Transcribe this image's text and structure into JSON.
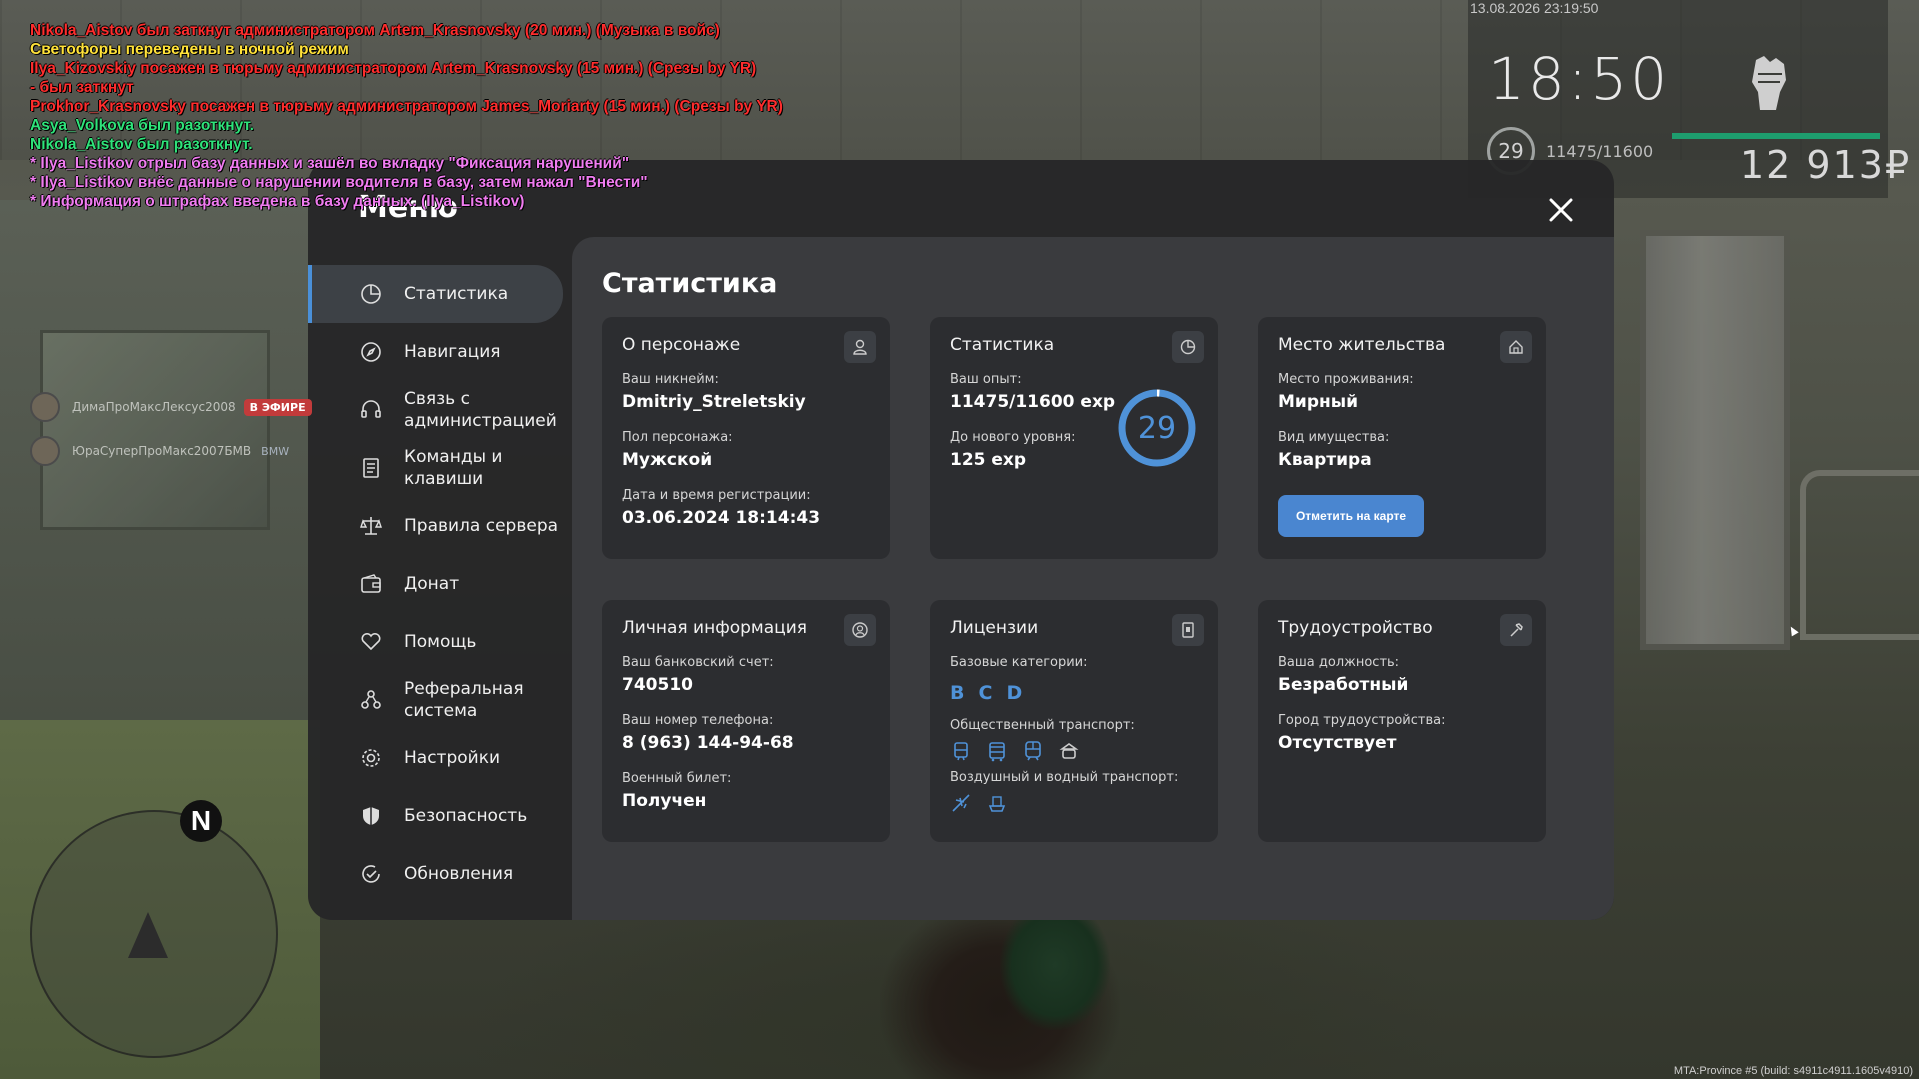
{
  "hud": {
    "datetime": "13.08.2026 23:19:50",
    "time": "18:50",
    "level": "29",
    "exp": "11475/11600",
    "money": "12 913₽",
    "icon": "fist-icon",
    "health_color": "#1e9d6e"
  },
  "chat": [
    {
      "text": "Nikola_Aistov был заткнут администратором Artem_Krasnovsky (20 мин.) (Музыка в войс)",
      "color": "#ff2d2d"
    },
    {
      "text": "Светофоры переведены в ночной режим",
      "color": "#ffe23a"
    },
    {
      "text": "Ilya_Kizovskiy посажен в тюрьму администратором Artem_Krasnovsky (15 мин.) (Срезы by YR)",
      "color": "#ff2d2d"
    },
    {
      "text": "- был заткнут",
      "color": "#ff2d2d"
    },
    {
      "text": "Prokhor_Krasnovsky посажен в тюрьму администратором James_Moriarty (15 мин.) (Срезы by YR)",
      "color": "#ff2d2d"
    },
    {
      "text": "Asya_Volkova был разоткнут.",
      "color": "#2fe37a"
    },
    {
      "text": "Nikola_Aistov был разоткнут.",
      "color": "#2fe37a"
    },
    {
      "text": "* Ilya_Listikov отрыл базу данных и зашёл во вкладку \"Фиксация нарушений\"",
      "color": "#f07cf0"
    },
    {
      "text": "* Ilya_Listikov внёс данные о нарушении водителя в базу, затем нажал \"Внести\"",
      "color": "#f07cf0"
    },
    {
      "text": "* Информация о штрафах введена в базу данных. (Ilya_Listikov)",
      "color": "#f07cf0"
    }
  ],
  "voice": [
    {
      "name": "ДимаПроМаксЛексус2008",
      "badge": "В ЭФИРЕ",
      "car": ""
    },
    {
      "name": "ЮраСуперПроМакс2007БМВ",
      "badge": "",
      "car": "BMW"
    }
  ],
  "radar": {
    "north": "N"
  },
  "build": "MTA:Province #5 (build: s4911c4911.1605v4910)",
  "menu": {
    "title": "Меню",
    "sidebar": [
      {
        "label": "Статистика",
        "icon": "chart-pie-icon"
      },
      {
        "label": "Навигация",
        "icon": "compass-icon"
      },
      {
        "label": "Связь с администрацией",
        "icon": "headset-icon"
      },
      {
        "label": "Команды и клавиши",
        "icon": "document-icon"
      },
      {
        "label": "Правила сервера",
        "icon": "scales-icon"
      },
      {
        "label": "Донат",
        "icon": "wallet-icon"
      },
      {
        "label": "Помощь",
        "icon": "heart-hand-icon"
      },
      {
        "label": "Реферальная система",
        "icon": "referral-icon"
      },
      {
        "label": "Настройки",
        "icon": "gear-icon"
      },
      {
        "label": "Безопасность",
        "icon": "shield-icon"
      },
      {
        "label": "Обновления",
        "icon": "update-icon"
      }
    ],
    "content_title": "Статистика",
    "cards": {
      "character": {
        "title": "О персонаже",
        "nickname_label": "Ваш никнейм:",
        "nickname": "Dmitriy_Streletskiy",
        "gender_label": "Пол персонажа:",
        "gender": "Мужской",
        "reg_label": "Дата и время регистрации:",
        "reg": "03.06.2024 18:14:43"
      },
      "stats": {
        "title": "Статистика",
        "exp_label": "Ваш опыт:",
        "exp": "11475/11600 exp",
        "next_label": "До нового уровня:",
        "next": "125 exp",
        "level": "29",
        "level_progress": 0.989
      },
      "residence": {
        "title": "Место жительства",
        "place_label": "Место проживания:",
        "place": "Мирный",
        "type_label": "Вид имущества:",
        "type": "Квартира",
        "button": "Отметить на карте"
      },
      "personal": {
        "title": "Личная информация",
        "bank_label": "Ваш банковский счет:",
        "bank": "740510",
        "phone_label": "Ваш номер телефона:",
        "phone": "8 (963) 144-94-68",
        "military_label": "Военный билет:",
        "military": "Получен"
      },
      "licenses": {
        "title": "Лицензии",
        "base_label": "Базовые категории:",
        "base": [
          "B",
          "C",
          "D"
        ],
        "public_label": "Общественный транспорт:",
        "public_icons": [
          "tram-icon",
          "bus-icon",
          "train-icon",
          "taxi-icon"
        ],
        "air_label": "Воздушный и водный транспорт:",
        "air_icons": [
          "plane-icon",
          "boat-icon"
        ]
      },
      "job": {
        "title": "Трудоустройство",
        "position_label": "Ваша должность:",
        "position": "Безработный",
        "city_label": "Город трудоустройства:",
        "city": "Отсутствует"
      }
    }
  },
  "colors": {
    "accent": "#4a90d9",
    "panel": "#2c2d30",
    "content": "#3a3b3e"
  }
}
